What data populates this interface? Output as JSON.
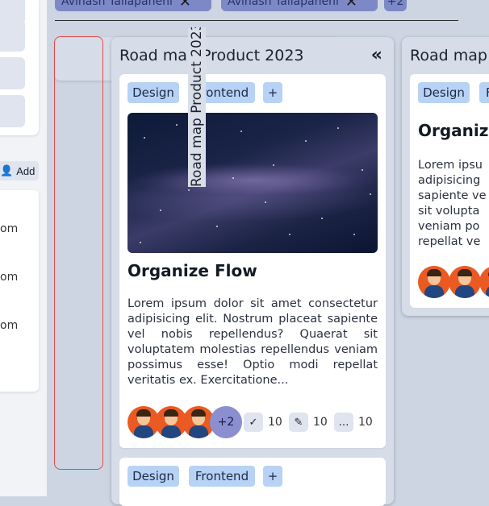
{
  "top_filters": [
    {
      "label": "Avinash Tallapaneni"
    },
    {
      "label": "Avinash Tallapaneni"
    },
    {
      "label": "+2"
    }
  ],
  "left_sidebar": {
    "add_label": "Add",
    "list_items": [
      "om",
      "om",
      "om"
    ]
  },
  "dragged_label": "Road map Product 2023",
  "column_main": {
    "title": "Road map Product 2023",
    "cards": [
      {
        "tags": [
          "Design",
          "Frontend"
        ],
        "title": "Organize Flow",
        "description": "Lorem ipsum dolor sit amet consectetur adipisicing elit. Nostrum placeat sapiente vel nobis repellendus? Quaerat sit voluptatem molestias repellendus veniam possimus esse! Optio modi repellat veritatis ex. Exercitatione...",
        "more_assignees": "+2",
        "checklist_count": "10",
        "attachments_count": "10",
        "comments_count": "10"
      },
      {
        "tags": [
          "Design",
          "Frontend"
        ]
      }
    ]
  },
  "column_right": {
    "title": "Road map",
    "card": {
      "tags": [
        "Design",
        "F"
      ],
      "title": "Organize",
      "description_lines": [
        "Lorem ipsu",
        "adipisicing",
        "sapiente ve",
        "sit volupta",
        "veniam po",
        "repellat ve"
      ]
    }
  },
  "colors": {
    "board_bg": "#cdd5e3",
    "column_bg": "#d6dce8",
    "tag_bg": "#b7d2f5",
    "avatar_bg": "#ea5a22",
    "more_avatar_bg": "#8b8fd0",
    "drop_outline": "#e04a4a"
  }
}
